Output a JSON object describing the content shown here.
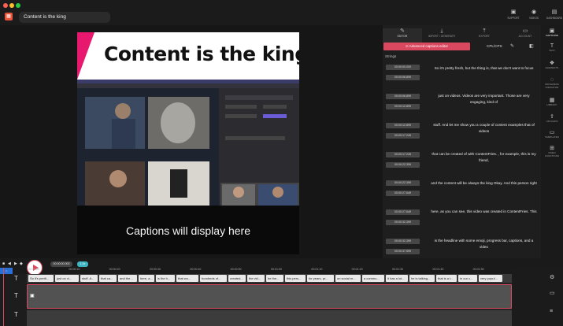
{
  "window": {
    "traffic_lights": [
      "#ff5f57",
      "#febc2e",
      "#28c840"
    ]
  },
  "header": {
    "project_title": "Content is the king",
    "buttons": [
      {
        "label": "Support",
        "icon": "support-icon"
      },
      {
        "label": "Videos",
        "icon": "videos-icon"
      },
      {
        "label": "Dashboard",
        "icon": "dashboard-icon"
      }
    ]
  },
  "preview": {
    "banner_title": "Content is the king",
    "caption_placeholder": "Captions will display here",
    "banner_accent": "#e7186e"
  },
  "panel": {
    "tabs": [
      {
        "label": "Editor",
        "icon": "pencil-icon"
      },
      {
        "label": "Import / Generate",
        "icon": "import-icon"
      },
      {
        "label": "Export",
        "icon": "export-icon"
      },
      {
        "label": "Account",
        "icon": "account-icon"
      }
    ],
    "advanced_button": "Advanced captions editor",
    "cps_label": "CPL/CPS",
    "strings_label": "Strings",
    "captions": [
      {
        "start": "00:00:00.000",
        "end": "00:00:06.899",
        "text": "So it's pretty fresh, but the thing is, that we don't want to focus"
      },
      {
        "start": "00:00:06.899",
        "end": "00:00:12.899",
        "text": "just on videos. Videos are very important. Those are very engaging, kind of"
      },
      {
        "start": "00:00:12.899",
        "end": "00:00:17.249",
        "text": "stuff. And let me show you a couple of content examples that of videos"
      },
      {
        "start": "00:00:17.249",
        "end": "00:00:22.399",
        "text": "that can be created of with ContentFries. , for example, this is my friend,"
      },
      {
        "start": "00:00:22.399",
        "end": "00:00:27.649",
        "text": "and the content will be always the king Okay. And this person right"
      },
      {
        "start": "00:00:27.649",
        "end": "00:00:32.399",
        "text": "here, as you can see, this video was created in ContentFries. This"
      },
      {
        "start": "00:00:32.399",
        "end": "00:00:37.599",
        "text": "is the headline with some emoji, progress bar, captions, and a video"
      }
    ],
    "accent": "#d9485e"
  },
  "rightnav": [
    {
      "label": "Captions",
      "icon": "captions-icon"
    },
    {
      "label": "Text",
      "icon": "text-icon"
    },
    {
      "label": "Elements",
      "icon": "elements-icon"
    },
    {
      "label": "Progress Indicator",
      "icon": "progress-icon"
    },
    {
      "label": "Library",
      "icon": "library-icon"
    },
    {
      "label": "Uploads",
      "icon": "uploads-icon"
    },
    {
      "label": "Templates",
      "icon": "templates-icon"
    },
    {
      "label": "Video Functions",
      "icon": "video-functions-icon"
    }
  ],
  "timeline": {
    "timecode": "00:00:00.000",
    "zoom": "1.0x",
    "ticks": [
      "00:00:00",
      "00:00:05",
      "00:00:10",
      "00:00:15",
      "00:00:20",
      "00:00:25",
      "00:00:30",
      "00:00:35",
      "00:00:40",
      "00:00:45",
      "00:00:50",
      "00:00:55",
      "00:01:00",
      "00:01:05",
      "00:01:10",
      "00:01:15",
      "00:01:20",
      "00:01:25",
      "00:01:30",
      "00:01:35",
      "00:01:40",
      "00:01:45",
      "00:01:50",
      "00:01:55"
    ],
    "chips": [
      "So it's pretti...",
      "just on vi...",
      "stuff. A...",
      "that ca...",
      "and the...",
      "here, a...",
      "is the h...",
      "that wo...",
      "hundreds of...",
      "created...",
      "the vid...",
      "be the...",
      "this pers...",
      "for years, pr...",
      "on social m...",
      "a commu...",
      "it has a lot...",
      "he is talking...",
      "that is a t...",
      "in our c...",
      "very popul..."
    ]
  }
}
